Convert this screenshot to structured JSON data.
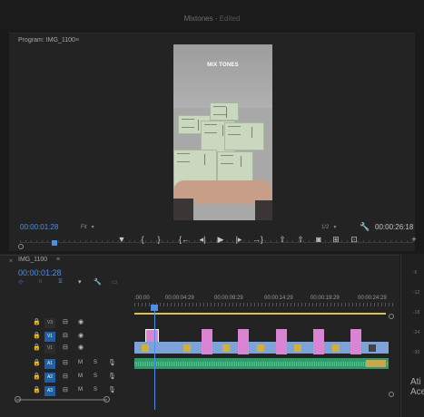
{
  "app": {
    "project_name": "Mixtones",
    "status": "- Edited"
  },
  "program_monitor": {
    "label": "Program: IMG_1100",
    "menu_icon": "≡",
    "video_overlay_text": "MIX TONES",
    "current_time": "00:00:01:28",
    "fit_label": "Fit",
    "resolution": "1/2",
    "duration": "00:00:26:18",
    "playhead_progress": 0.08
  },
  "transport": {
    "buttons": [
      "▼",
      "{",
      "}",
      "{←",
      "◂|",
      "▶",
      "|▸",
      "→}",
      "⇧",
      "⇧",
      "◙",
      "⊞",
      "⊡",
      "+"
    ],
    "icons": [
      "add-marker-icon",
      "mark-in-icon",
      "mark-out-icon",
      "go-to-in-icon",
      "step-back-icon",
      "play-icon",
      "step-forward-icon",
      "go-to-out-icon",
      "lift-icon",
      "extract-icon",
      "export-frame-icon",
      "insert-icon",
      "overwrite-icon",
      "add-button-icon"
    ]
  },
  "timeline": {
    "close_icon": "×",
    "sequence_name": "IMG_1100",
    "menu_icon": "≡",
    "current_time": "00:00:01:28",
    "ruler_labels": [
      ":00:00",
      "00:00:04:29",
      "00:00:09:29",
      "00:00:14:29",
      "00:00:19:29",
      "00:00:24:29"
    ],
    "video_tracks": [
      {
        "source": "",
        "target": "V3"
      },
      {
        "source": "V1",
        "target": "V2"
      },
      {
        "source": "",
        "target": "V1"
      }
    ],
    "audio_tracks": [
      {
        "source": "A1",
        "target": "A1",
        "m": "M",
        "s": "S"
      },
      {
        "source": "",
        "target": "A2",
        "m": "M",
        "s": "S"
      },
      {
        "source": "",
        "target": "A3",
        "m": "M",
        "s": "S"
      }
    ]
  },
  "meter_labels": [
    "-6",
    "-12",
    "-18",
    "-24",
    "-30"
  ],
  "right_panel_text": "Ati\nAce",
  "colors": {
    "accent_blue": "#4d8ee8",
    "video_clip": "#7da3d8",
    "pink_clip": "#da84d4",
    "audio_clip": "#2f9a6b",
    "work_area": "#d6c54b"
  }
}
